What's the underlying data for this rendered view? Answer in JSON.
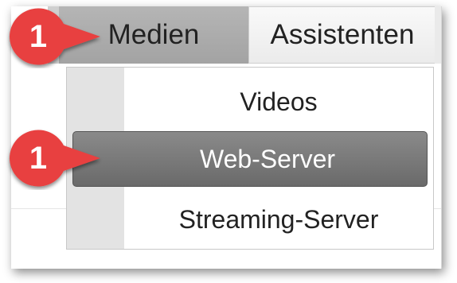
{
  "menubar": {
    "medien_label": "Medien",
    "assistenten_label": "Assistenten"
  },
  "dropdown": {
    "items": [
      {
        "label": "Videos",
        "selected": false
      },
      {
        "label": "Web-Server",
        "selected": true
      },
      {
        "label": "Streaming-Server",
        "selected": false
      }
    ]
  },
  "callouts": [
    {
      "number": "1",
      "icon": "callout-marker-icon",
      "color": "#e8403f"
    },
    {
      "number": "1",
      "icon": "callout-marker-icon",
      "color": "#e8403f"
    }
  ],
  "colors": {
    "active_menu": "#a8a8a8",
    "selected_item": "#747474",
    "callout": "#e8403f"
  }
}
